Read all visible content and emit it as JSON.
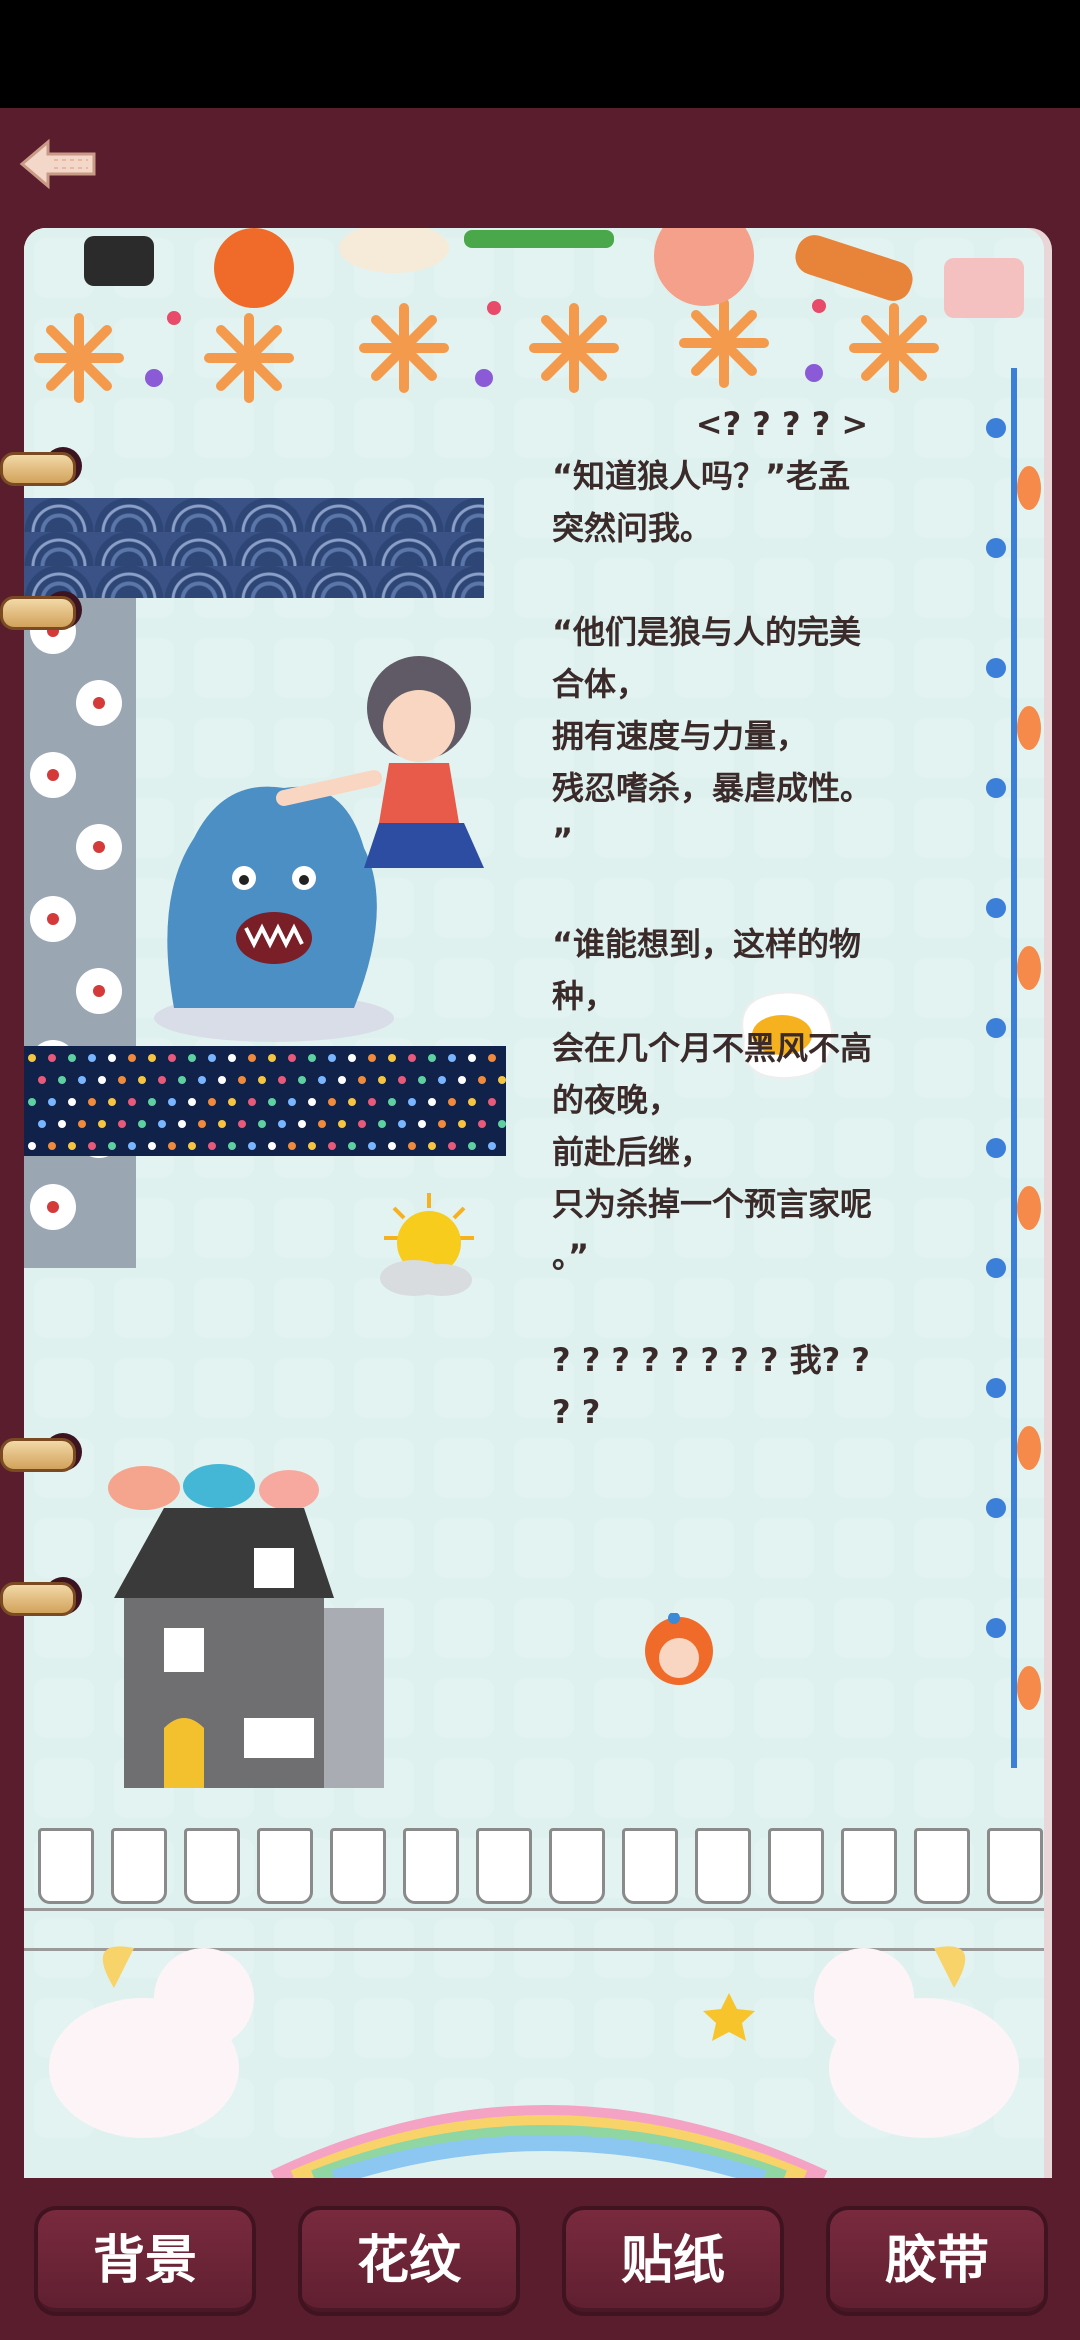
{
  "nav": {
    "back_icon": "back-arrow-icon"
  },
  "page": {
    "heading": "<? ? ? ? >",
    "paragraphs": [
      [
        "“知道狼人吗？”老孟",
        "突然问我。"
      ],
      [
        "“他们是狼与人的完美",
        "合体，",
        "拥有速度与力量，",
        "残忍嗜杀，暴虐成性。",
        "”"
      ],
      [
        "“谁能想到，这样的物",
        "种，",
        "会在几个月不黑风不高",
        "的夜晚，",
        "前赴后继，",
        "只为杀掉一个预言家呢",
        "。”"
      ],
      [
        "? ? ? ? ? ? ? ? 我? ?",
        "? ?"
      ]
    ]
  },
  "tabs": [
    {
      "label": "背景"
    },
    {
      "label": "花纹"
    },
    {
      "label": "贴纸"
    },
    {
      "label": "胶带"
    }
  ],
  "colors": {
    "background": "#5a1d2e",
    "page": "#f7fbfb",
    "button": "#6e2537",
    "text": "#3a2a2a"
  }
}
